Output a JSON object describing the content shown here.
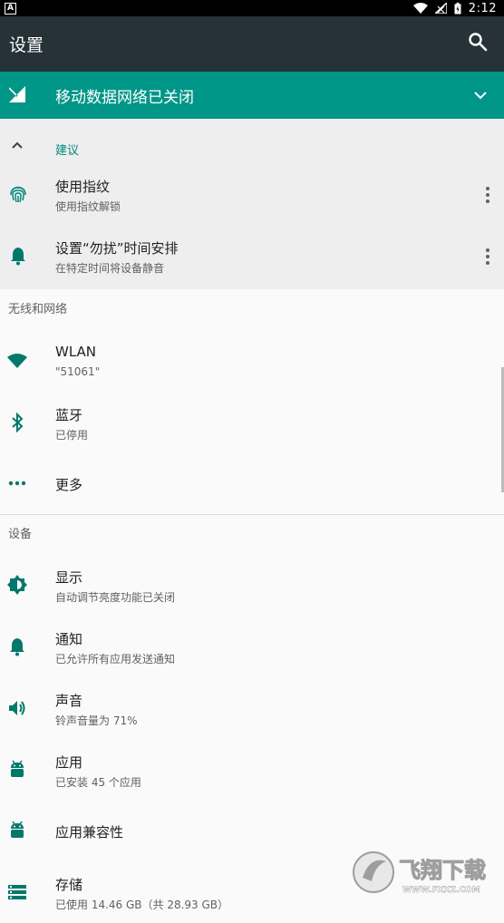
{
  "status_bar": {
    "time": "2:12",
    "left_icon": "A"
  },
  "toolbar": {
    "title": "设置"
  },
  "banner": {
    "text": "移动数据网络已关闭"
  },
  "suggestions": {
    "header": "建议",
    "items": [
      {
        "title": "使用指纹",
        "subtitle": "使用指纹解锁",
        "icon": "fingerprint-icon"
      },
      {
        "title": "设置“勿扰”时间安排",
        "subtitle": "在特定时间将设备静音",
        "icon": "bell-icon"
      }
    ]
  },
  "wireless": {
    "title": "无线和网络",
    "items": [
      {
        "title": "WLAN",
        "subtitle": "\"51061\"",
        "icon": "wifi-icon"
      },
      {
        "title": "蓝牙",
        "subtitle": "已停用",
        "icon": "bluetooth-icon"
      },
      {
        "title": "更多",
        "icon": "more-horiz-icon"
      }
    ]
  },
  "device": {
    "title": "设备",
    "items": [
      {
        "title": "显示",
        "subtitle": "自动调节亮度功能已关闭",
        "icon": "brightness-icon"
      },
      {
        "title": "通知",
        "subtitle": "已允许所有应用发送通知",
        "icon": "bell-icon"
      },
      {
        "title": "声音",
        "subtitle": "铃声音量为 71%",
        "icon": "volume-icon"
      },
      {
        "title": "应用",
        "subtitle": "已安装 45 个应用",
        "icon": "android-icon"
      },
      {
        "title": "应用兼容性",
        "icon": "android-icon"
      },
      {
        "title": "存储",
        "subtitle": "已使用 14.46 GB（共 28.93 GB）",
        "icon": "storage-icon"
      }
    ]
  },
  "watermark": {
    "brand": "飞翔下载",
    "url": "WWW.FXXZ.COM"
  },
  "colors": {
    "toolbar": "#263238",
    "accent": "#009688",
    "icon": "#00796b"
  }
}
